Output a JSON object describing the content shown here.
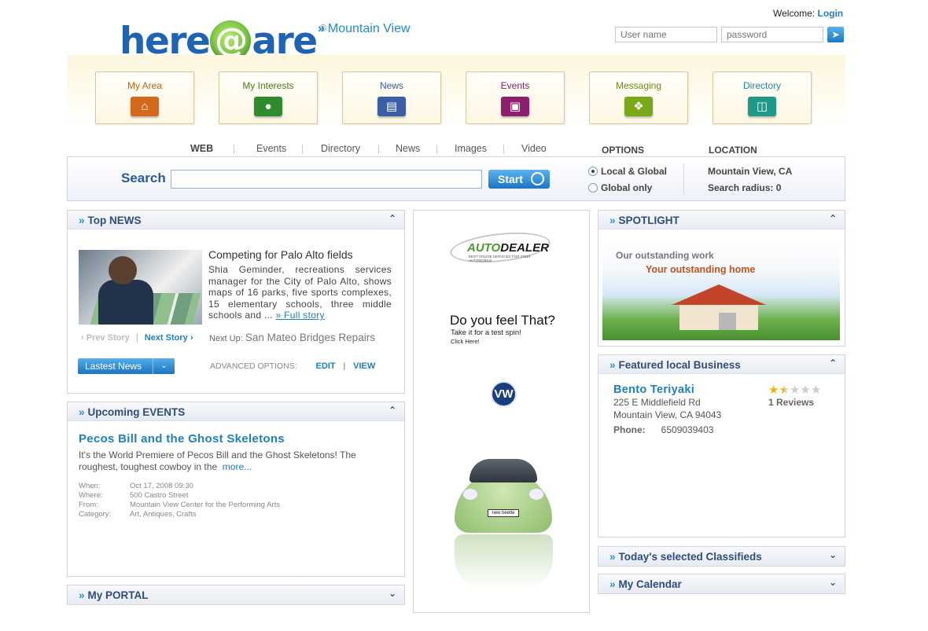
{
  "header": {
    "logo": {
      "part1": "here",
      "at": "@",
      "part2": "are",
      "reg": "®"
    },
    "city_prefix": "»",
    "city": "Mountain View",
    "welcome": "Welcome:",
    "login": "Login",
    "username_placeholder": "User name",
    "password_placeholder": "password",
    "go_icon": "arrow-right-icon"
  },
  "nav": [
    {
      "label": "My Area",
      "icon": "home-icon",
      "color": "#d4691a",
      "text_color": "#c0611c"
    },
    {
      "label": "My Interests",
      "icon": "lightbulb-icon",
      "color": "#2e8b2e",
      "text_color": "#4a7a1e"
    },
    {
      "label": "News",
      "icon": "document-icon",
      "color": "#3a5fa6",
      "text_color": "#3a5fa6"
    },
    {
      "label": "Events",
      "icon": "cake-icon",
      "color": "#8c1f6e",
      "text_color": "#8c1f6e"
    },
    {
      "label": "Messaging",
      "icon": "chat-icon",
      "color": "#79a818",
      "text_color": "#6b8e12"
    },
    {
      "label": "Directory",
      "icon": "book-icon",
      "color": "#1f9a8a",
      "text_color": "#1a8a9a"
    }
  ],
  "search": {
    "tabs": [
      "WEB",
      "Events",
      "Directory",
      "News",
      "Images",
      "Video"
    ],
    "options_label": "OPTIONS",
    "location_label": "LOCATION",
    "label": "Search",
    "value": "",
    "button": "Start",
    "options": [
      {
        "label": "Local & Global",
        "selected": true
      },
      {
        "label": "Global only",
        "selected": false
      }
    ],
    "location": "Mountain View, CA",
    "radius": "Search radius: 0"
  },
  "top_news": {
    "prefix": "»",
    "title": "Top NEWS",
    "story_title": "Competing for Palo Alto fields",
    "story_text": "Shia Geminder, recreations services manager for the City of Palo Alto, shows maps of 16 parks, five sports complexes, 15 elementary schools, three middle schools and ...",
    "full_story": "» Full story",
    "prev": "Prev Story",
    "next": "Next Story",
    "next_up_label": "Next Up:",
    "next_up": "San Mateo Bridges Repairs",
    "latest_button": "Lastest News",
    "advanced_label": "ADVANCED OPTIONS:",
    "edit": "EDIT",
    "view": "VIEW"
  },
  "events": {
    "prefix": "»",
    "title": "Upcoming EVENTS",
    "event_title": "Pecos Bill and the Ghost Skeletons",
    "text": "It's the World Premiere of Pecos Bill and the Ghost Skeletons! The roughest, toughest cowboy in the",
    "more": "more...",
    "details": [
      {
        "label": "When:",
        "value": "Oct 17, 2008 09:30"
      },
      {
        "label": "Where:",
        "value": "500 Castro Street"
      },
      {
        "label": "From:",
        "value": "Mountain View Center for the Performing Arts"
      },
      {
        "label": "Category:",
        "value": "Art, Antiques, Crafts"
      }
    ]
  },
  "portal": {
    "prefix": "»",
    "title": "My PORTAL"
  },
  "ad": {
    "logo_a": "AUTO",
    "logo_b": "DEALER",
    "tagline": "BEST ONLINE SERVICES FOR YOUR AUTOMOBILE",
    "question": "Do you feel That?",
    "sub": "Take it for a test spin!",
    "click": "Click Here!",
    "brand": "VW",
    "plate": "new beetle"
  },
  "spotlight": {
    "prefix": "»",
    "title": "SPOTLIGHT",
    "line1": "Our outstanding work",
    "line2": "Your outstanding home"
  },
  "business": {
    "prefix": "»",
    "title": "Featured local Business",
    "name": "Bento Teriyaki",
    "address1": "225 E Middlefield Rd",
    "address2": "Mountain View, CA 94043",
    "phone_label": "Phone:",
    "phone": "6509039403",
    "rating": 1.5,
    "rating_max": 5,
    "reviews": "1 Reviews"
  },
  "classifieds": {
    "prefix": "»",
    "title": "Today's selected Classifieds"
  },
  "calendar": {
    "prefix": "»",
    "title": "My Calendar"
  }
}
